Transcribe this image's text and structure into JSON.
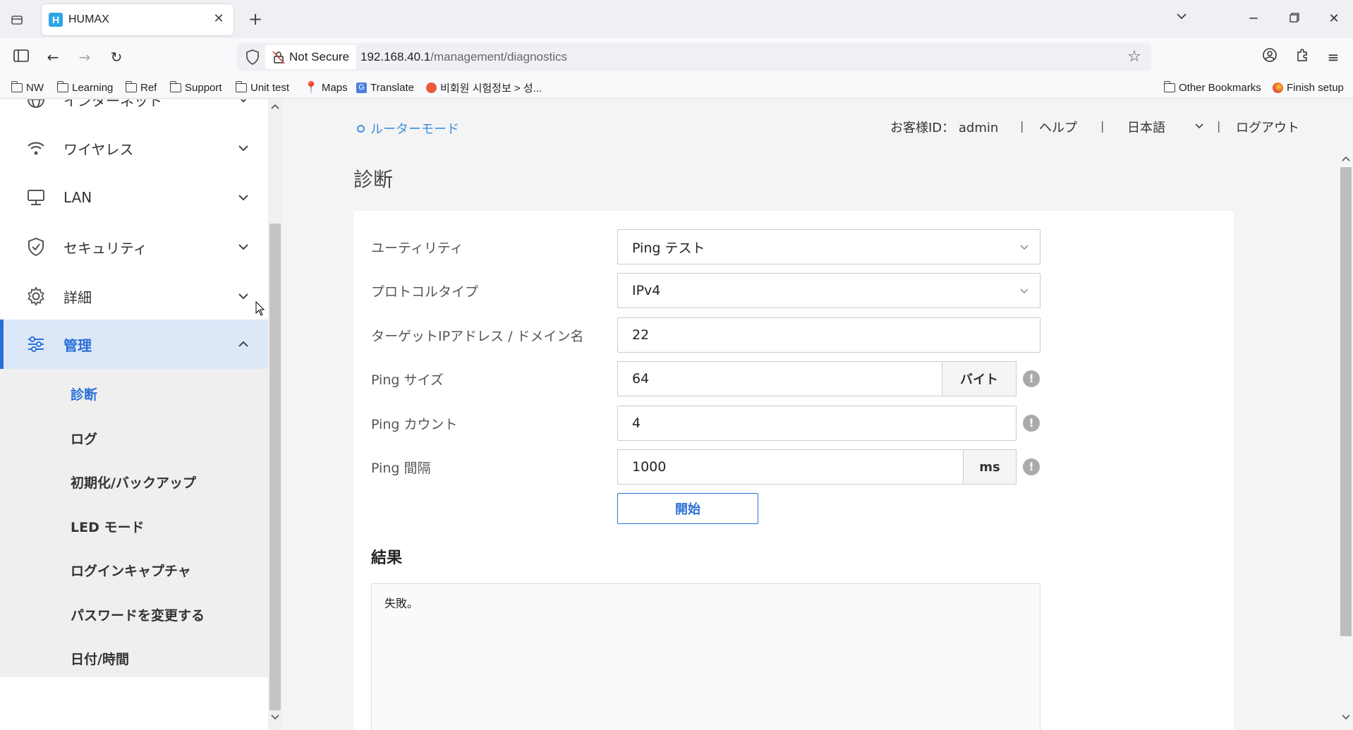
{
  "browser": {
    "tab_title": "HUMAX",
    "tab_favicon_letter": "H",
    "security_label": "Not Secure",
    "url_host": "192.168.40.1",
    "url_path": "/management/diagnostics",
    "bookmarks": [
      "NW",
      "Learning",
      "Ref",
      "Support",
      "Unit test",
      "Maps",
      "Translate",
      "비회원 시험정보 > 성...",
      "Other Bookmarks",
      "Finish setup"
    ]
  },
  "header": {
    "mode": "ルーターモード",
    "customer_id": "お客様ID： admin",
    "help": "ヘルプ",
    "language": "日本語",
    "logout": "ログアウト",
    "separator": "|"
  },
  "sidebar": {
    "items": [
      {
        "label": "インターネット"
      },
      {
        "label": "ワイヤレス"
      },
      {
        "label": "LAN"
      },
      {
        "label": "セキュリティ"
      },
      {
        "label": "詳細"
      },
      {
        "label": "管理"
      }
    ],
    "submenu": [
      "診断",
      "ログ",
      "初期化/バックアップ",
      "LED モード",
      "ログインキャプチャ",
      "パスワードを変更する",
      "日付/時間"
    ]
  },
  "main": {
    "title": "診断",
    "form": {
      "utility_label": "ユーティリティ",
      "utility_value": "Ping テスト",
      "protocol_label": "プロトコルタイプ",
      "protocol_value": "IPv4",
      "target_label": "ターゲットIPアドレス / ドメイン名",
      "target_value": "22",
      "size_label": "Ping サイズ",
      "size_value": "64",
      "size_unit": "バイト",
      "count_label": "Ping カウント",
      "count_value": "4",
      "interval_label": "Ping 間隔",
      "interval_value": "1000",
      "interval_unit": "ms",
      "info_glyph": "!",
      "start_label": "開始"
    },
    "result_title": "結果",
    "result_text": "失敗。"
  },
  "colors": {
    "accent": "#2a6fd6",
    "mode_link": "#3d8fe0",
    "active_bg": "#dce8f8"
  }
}
